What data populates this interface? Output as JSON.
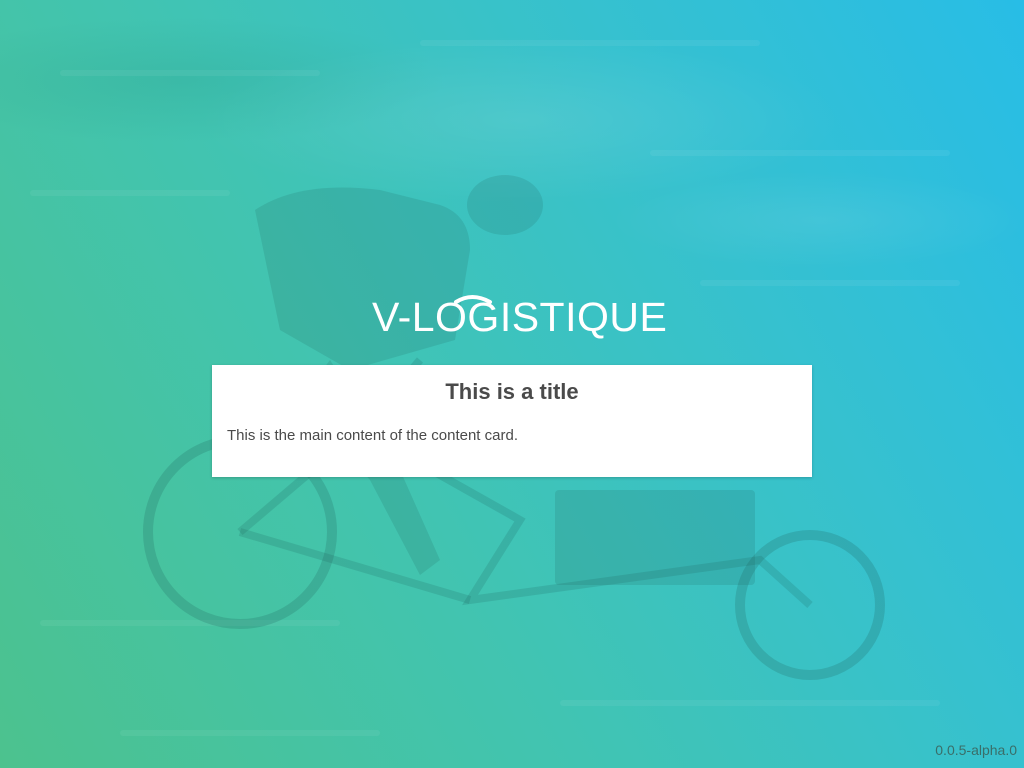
{
  "brand": {
    "logo_text": "V-LOGISTIQUE"
  },
  "card": {
    "title": "This is a title",
    "content": "This is the main content of the content card."
  },
  "footer": {
    "version": "0.0.5-alpha.0"
  },
  "colors": {
    "gradient_start": "#4cc28e",
    "gradient_end": "#28bde6",
    "card_background": "#ffffff",
    "card_text": "#4a4a4a"
  },
  "background_image": "cargo-bike-rider-motion-blur"
}
